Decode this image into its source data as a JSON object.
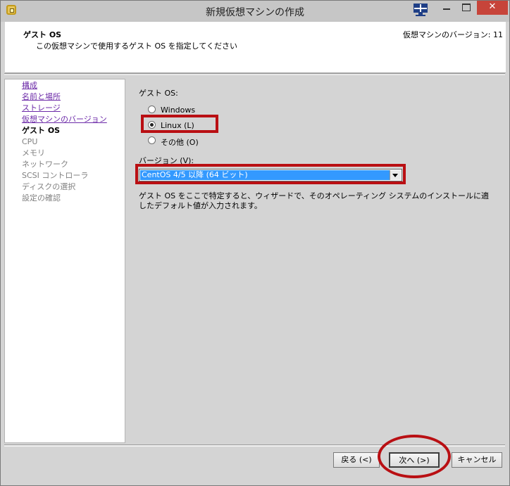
{
  "window": {
    "title": "新規仮想マシンの作成"
  },
  "header": {
    "title": "ゲスト OS",
    "subtitle": "この仮想マシンで使用するゲスト OS を指定してください",
    "vm_version": "仮想マシンのバージョン: 11"
  },
  "nav": {
    "items": [
      {
        "label": "構成",
        "state": "link"
      },
      {
        "label": "名前と場所",
        "state": "link"
      },
      {
        "label": "ストレージ",
        "state": "link"
      },
      {
        "label": "仮想マシンのバージョン",
        "state": "link"
      },
      {
        "label": "ゲスト OS",
        "state": "current"
      },
      {
        "label": "CPU",
        "state": "disabled"
      },
      {
        "label": "メモリ",
        "state": "disabled"
      },
      {
        "label": "ネットワーク",
        "state": "disabled"
      },
      {
        "label": "SCSI コントローラ",
        "state": "disabled"
      },
      {
        "label": "ディスクの選択",
        "state": "disabled"
      },
      {
        "label": "設定の確認",
        "state": "disabled"
      }
    ]
  },
  "guest_os": {
    "label": "ゲスト OS:",
    "options": [
      {
        "label": "Windows",
        "selected": false
      },
      {
        "label": "Linux (L)",
        "selected": true
      },
      {
        "label": "その他 (O)",
        "selected": false
      }
    ]
  },
  "version": {
    "label": "バージョン (V):",
    "selected": "CentOS 4/5 以降 (64 ビット)"
  },
  "description": "ゲスト OS をここで特定すると、ウィザードで、そのオペレーティング システムのインストールに適したデフォルト値が入力されます。",
  "buttons": {
    "back": "戻る (<)",
    "next": "次へ (>)",
    "cancel": "キャンセル"
  },
  "colors": {
    "highlight": "#b90f13",
    "selection": "#3399ff",
    "link": "#6c2aa8",
    "close_button": "#c7443a"
  }
}
